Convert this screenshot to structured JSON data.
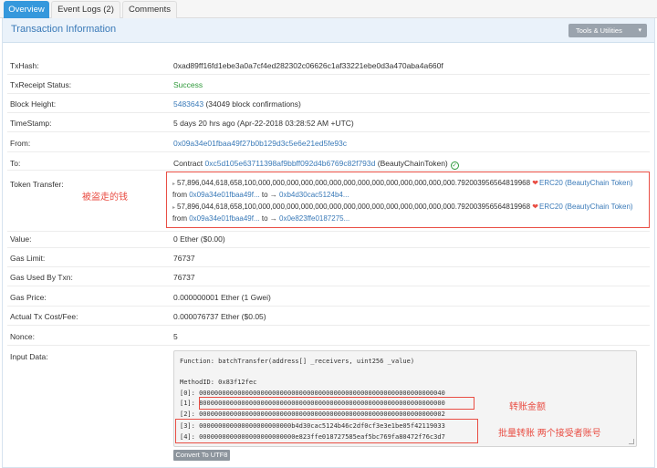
{
  "tabs": [
    {
      "label": "Overview",
      "active": true
    },
    {
      "label": "Event Logs (2)",
      "active": false
    },
    {
      "label": "Comments",
      "active": false
    }
  ],
  "header": {
    "title": "Transaction Information",
    "tools_label": "Tools & Utilities",
    "tools_caret": "▾"
  },
  "rows": {
    "txhash": {
      "label": "TxHash:",
      "value": "0xad89ff16fd1ebe3a0a7cf4ed282302c06626c1af33221ebe0d3a470aba4a660f"
    },
    "status": {
      "label": "TxReceipt Status:",
      "value": "Success"
    },
    "block": {
      "label": "Block Height:",
      "link": "5483643",
      "extra": " (34049 block confirmations)"
    },
    "timestamp": {
      "label": "TimeStamp:",
      "value": "5 days 20 hrs ago (Apr-22-2018 03:28:52 AM +UTC)"
    },
    "from": {
      "label": "From:",
      "value": "0x09a34e01fbaa49f27b0b129d3c5e6e21ed5fe93c"
    },
    "to": {
      "label": "To:",
      "prefix": "Contract ",
      "link": "0xc5d105e63711398af9bbff092d4b6769c82f793d",
      "suffix": " (BeautyChainToken)"
    },
    "token": {
      "label": "Token Transfer:"
    },
    "value_row": {
      "label": "Value:",
      "value": "0 Ether ($0.00)"
    },
    "gas_limit": {
      "label": "Gas Limit:",
      "value": "76737"
    },
    "gas_used": {
      "label": "Gas Used By Txn:",
      "value": "76737"
    },
    "gas_price": {
      "label": "Gas Price:",
      "value": "0.000000001 Ether (1 Gwei)"
    },
    "cost": {
      "label": "Actual Tx Cost/Fee:",
      "value": "0.000076737 Ether ($0.05)"
    },
    "nonce": {
      "label": "Nonce:",
      "value": "5"
    },
    "input": {
      "label": "Input Data:"
    }
  },
  "token_transfers": [
    {
      "amount": "57,896,044,618,658,100,000,000,000,000,000,000,000,000,000,000,000,000,000,000.792003956564819968",
      "token": "ERC20 (BeautyChain Token)",
      "from_label": "from ",
      "from": "0x09a34e01fbaa49f...",
      "to_label": " to ",
      "to": "0xb4d30cac5124b4..."
    },
    {
      "amount": "57,896,044,618,658,100,000,000,000,000,000,000,000,000,000,000,000,000,000,000.792003956564819968",
      "token": "ERC20 (BeautyChain Token)",
      "from_label": "from ",
      "from": "0x09a34e01fbaa49f...",
      "to_label": " to ",
      "to": "0x0e823ffe0187275..."
    }
  ],
  "input_data": {
    "function": "Function: batchTransfer(address[] _receivers, uint256 _value)",
    "method": "MethodID: 0x83f12fec",
    "lines": [
      "[0]:  0000000000000000000000000000000000000000000000000000000000000040",
      "[1]:  8000000000000000000000000000000000000000000000000000000000000000",
      "[2]:  0000000000000000000000000000000000000000000000000000000000000002",
      "[3]:  000000000000000000000000b4d30cac5124b46c2df0cf3e3e1be05f42119033",
      "[4]:  0000000000000000000000000e823ffe018727585eaf5bc769fa80472f76c3d7"
    ]
  },
  "annotations": {
    "stolen": "被盗走的钱",
    "amount": "转账金额",
    "batch": "批量转账 两个接受者账号"
  },
  "buttons": {
    "convert": "Convert To UTF8"
  },
  "colors": {
    "accent": "#3598dc",
    "link": "#3a7ab8",
    "success": "#2f9a3b",
    "highlight": "#e94e44"
  }
}
